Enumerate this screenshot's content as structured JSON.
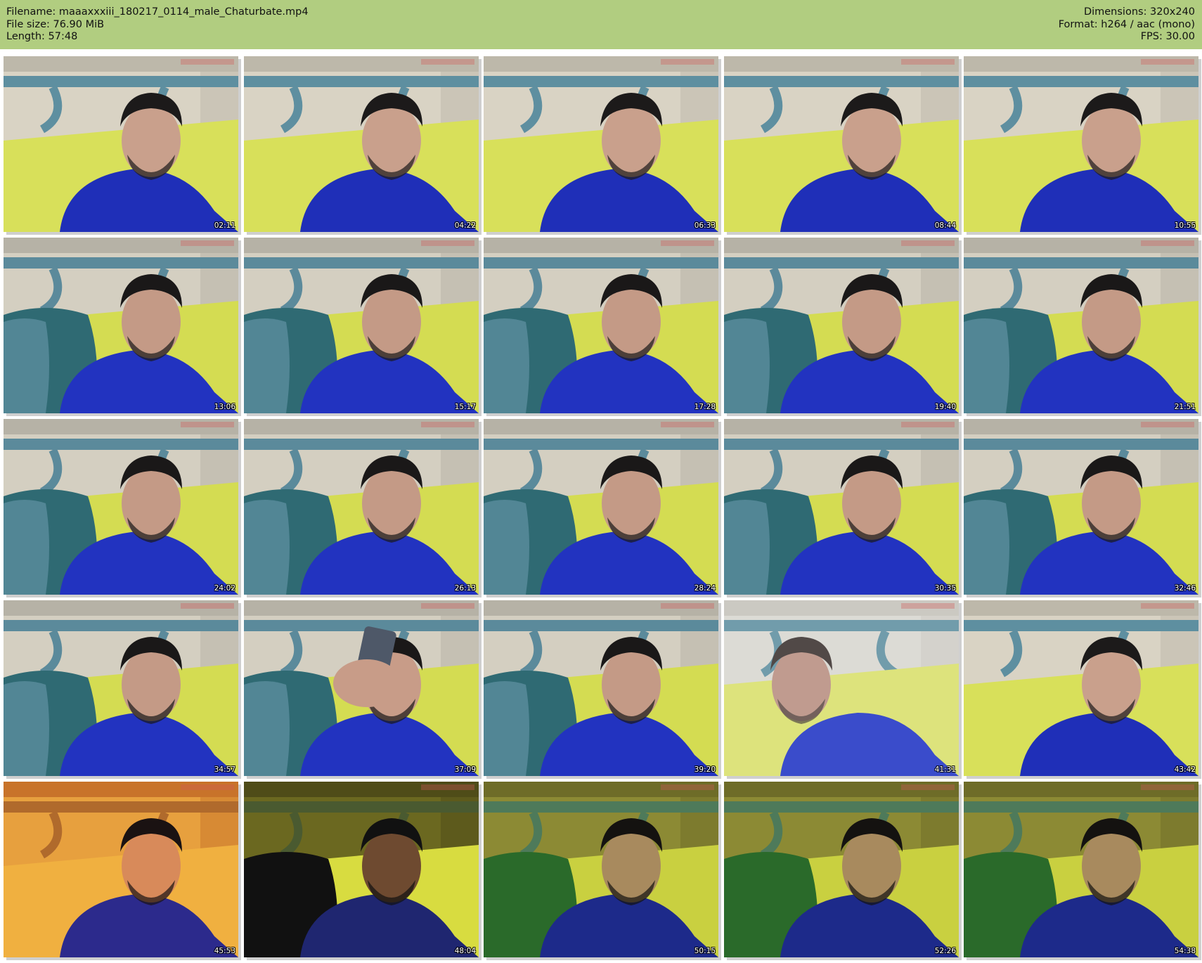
{
  "header": {
    "filename": "Filename: maaaxxxiii_180217_0114_male_Chaturbate.mp4",
    "filesize": "File size: 76.90 MiB",
    "length": "Length: 57:48",
    "dimensions": "Dimensions: 320x240",
    "format": "Format: h264 / aac (mono)",
    "fps": "FPS: 30.00"
  },
  "colors": {
    "header_bg": "#b1cd80",
    "shirt": "#1f2fb8",
    "pillow": "#d8e05a",
    "headboard": "#5e8fa0",
    "blanket": "#2f6a73"
  },
  "frames": [
    {
      "time": "02:11",
      "tone": "day"
    },
    {
      "time": "04:22",
      "tone": "day"
    },
    {
      "time": "06:33",
      "tone": "day"
    },
    {
      "time": "08:44",
      "tone": "day"
    },
    {
      "time": "10:55",
      "tone": "day"
    },
    {
      "time": "13:06",
      "tone": "blanket"
    },
    {
      "time": "15:17",
      "tone": "blanket"
    },
    {
      "time": "17:28",
      "tone": "blanket"
    },
    {
      "time": "19:40",
      "tone": "blanket"
    },
    {
      "time": "21:51",
      "tone": "blanket"
    },
    {
      "time": "24:02",
      "tone": "blanket"
    },
    {
      "time": "26:13",
      "tone": "blanket"
    },
    {
      "time": "28:24",
      "tone": "blanket"
    },
    {
      "time": "30:35",
      "tone": "blanket"
    },
    {
      "time": "32:46",
      "tone": "blanket"
    },
    {
      "time": "34:57",
      "tone": "blanket"
    },
    {
      "time": "37:09",
      "tone": "phone"
    },
    {
      "time": "39:20",
      "tone": "blanket"
    },
    {
      "time": "41:31",
      "tone": "blur"
    },
    {
      "time": "43:42",
      "tone": "day"
    },
    {
      "time": "45:53",
      "tone": "orange"
    },
    {
      "time": "48:04",
      "tone": "dark"
    },
    {
      "time": "50:15",
      "tone": "green"
    },
    {
      "time": "52:26",
      "tone": "green"
    },
    {
      "time": "54:38",
      "tone": "green"
    }
  ]
}
